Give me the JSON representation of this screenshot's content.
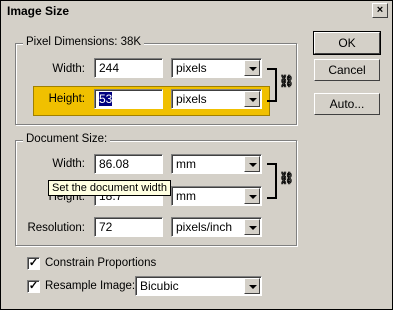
{
  "window": {
    "title": "Image Size",
    "close_glyph": "×"
  },
  "pixel_dimensions": {
    "label": "Pixel Dimensions:",
    "size": "38K",
    "width_label": "Width:",
    "width_value": "244",
    "width_unit": "pixels",
    "height_label": "Height:",
    "height_value": "53",
    "height_unit": "pixels"
  },
  "document_size": {
    "label": "Document Size:",
    "width_label": "Width:",
    "width_value": "86.08",
    "width_unit": "mm",
    "height_label": "Height:",
    "height_value": "18.7",
    "height_unit": "mm",
    "resolution_label": "Resolution:",
    "resolution_value": "72",
    "resolution_unit": "pixels/inch"
  },
  "tooltip": "Set the document width",
  "options": {
    "constrain_label": "Constrain Proportions",
    "constrain_checked": "✓",
    "resample_label": "Resample Image:",
    "resample_checked": "✓",
    "resample_method": "Bicubic"
  },
  "buttons": {
    "ok": "OK",
    "cancel": "Cancel",
    "auto": "Auto..."
  },
  "icons": {
    "link": "chain-link-icon"
  },
  "colors": {
    "highlight": "#f0c000",
    "tooltip_bg": "#ffffe1"
  }
}
